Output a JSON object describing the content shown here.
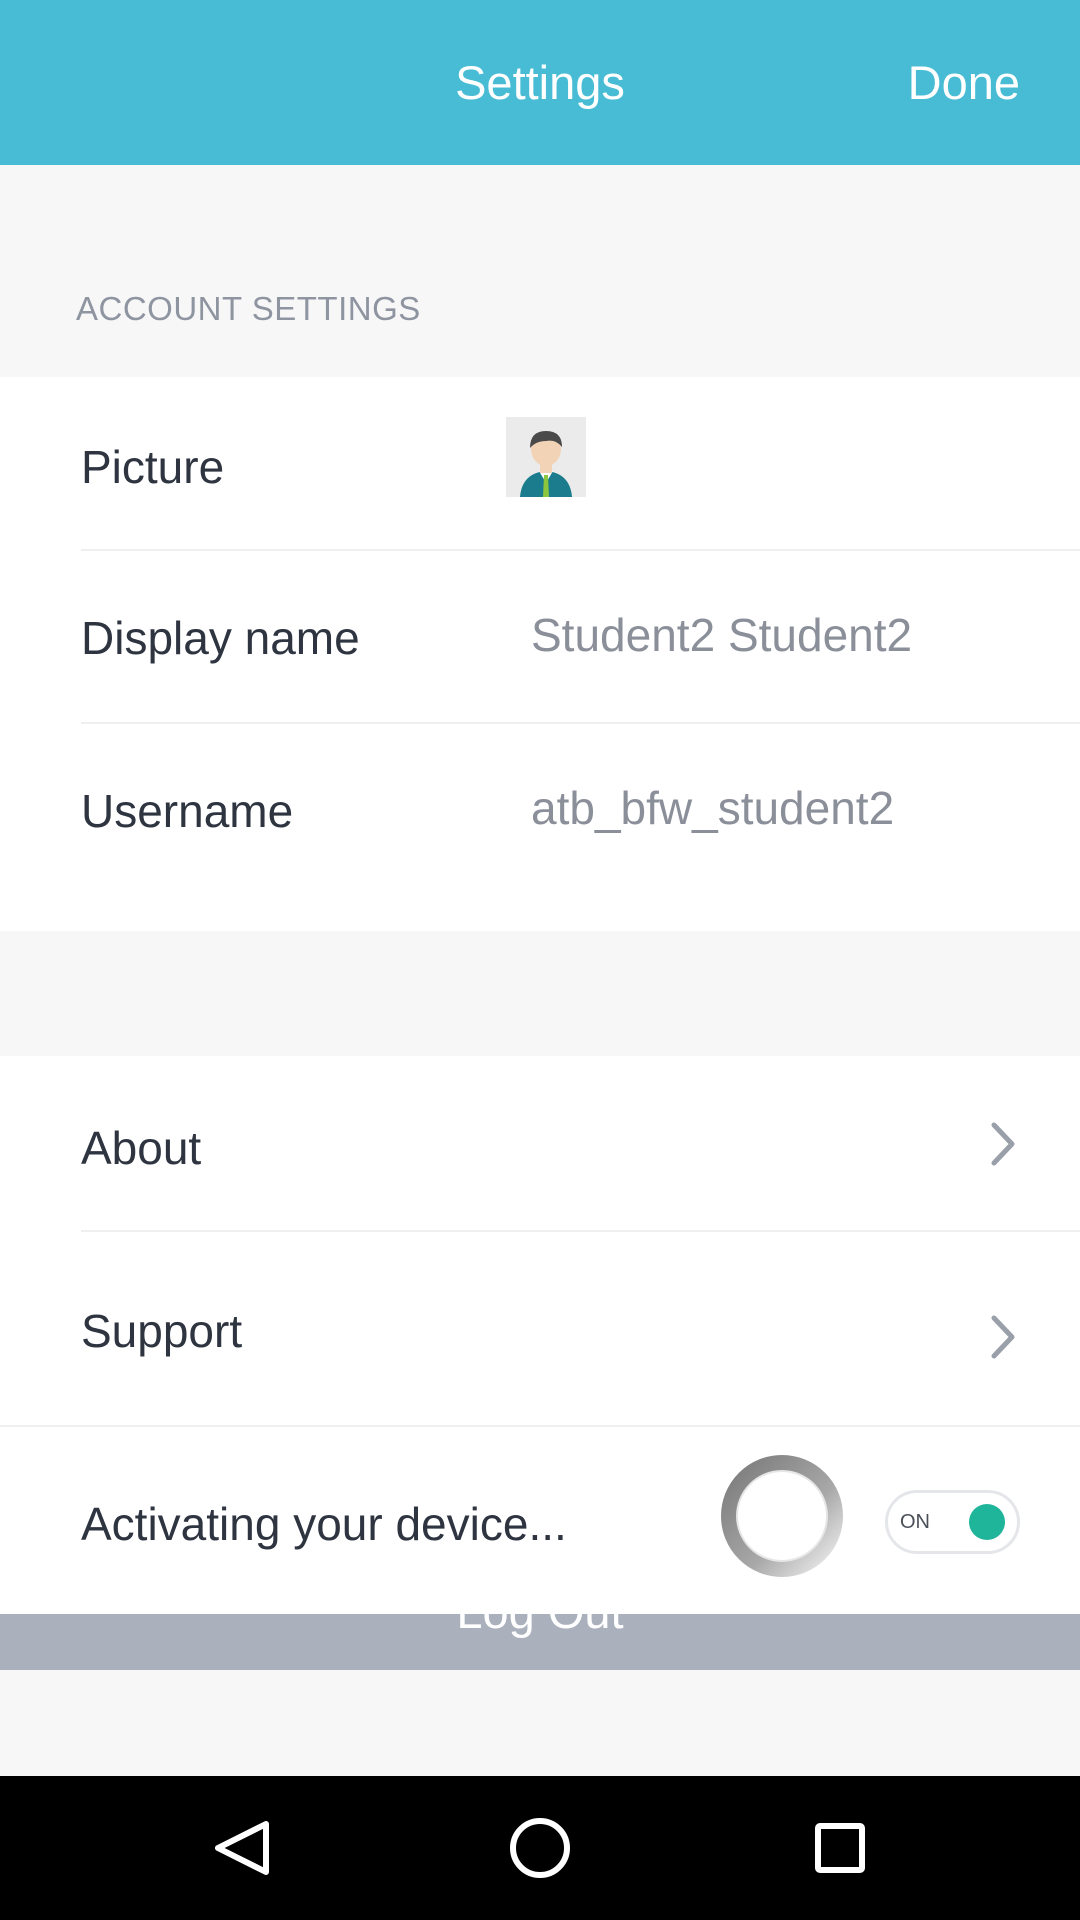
{
  "header": {
    "title": "Settings",
    "done_label": "Done",
    "background_color": "#47bcd4"
  },
  "account_section": {
    "label": "ACCOUNT SETTINGS",
    "rows": {
      "picture": {
        "label": "Picture",
        "icon": "user-avatar-icon"
      },
      "display_name": {
        "label": "Display name",
        "value": "Student2 Student2"
      },
      "username": {
        "label": "Username",
        "value": "atb_bfw_student2"
      }
    }
  },
  "links_section": {
    "about": {
      "label": "About",
      "icon": "chevron-right-icon"
    },
    "support": {
      "label": "Support",
      "icon": "chevron-right-icon"
    },
    "activation": {
      "label": "Activating your device...",
      "spinner_icon": "loading-spinner-icon",
      "toggle_text": "ON",
      "toggle_state": true,
      "toggle_color": "#1fb59b"
    }
  },
  "logout": {
    "label": "Log Out",
    "background_color": "#aab1bd"
  },
  "system_nav": {
    "back_icon": "back-triangle-icon",
    "home_icon": "home-circle-icon",
    "recents_icon": "recents-square-icon"
  }
}
